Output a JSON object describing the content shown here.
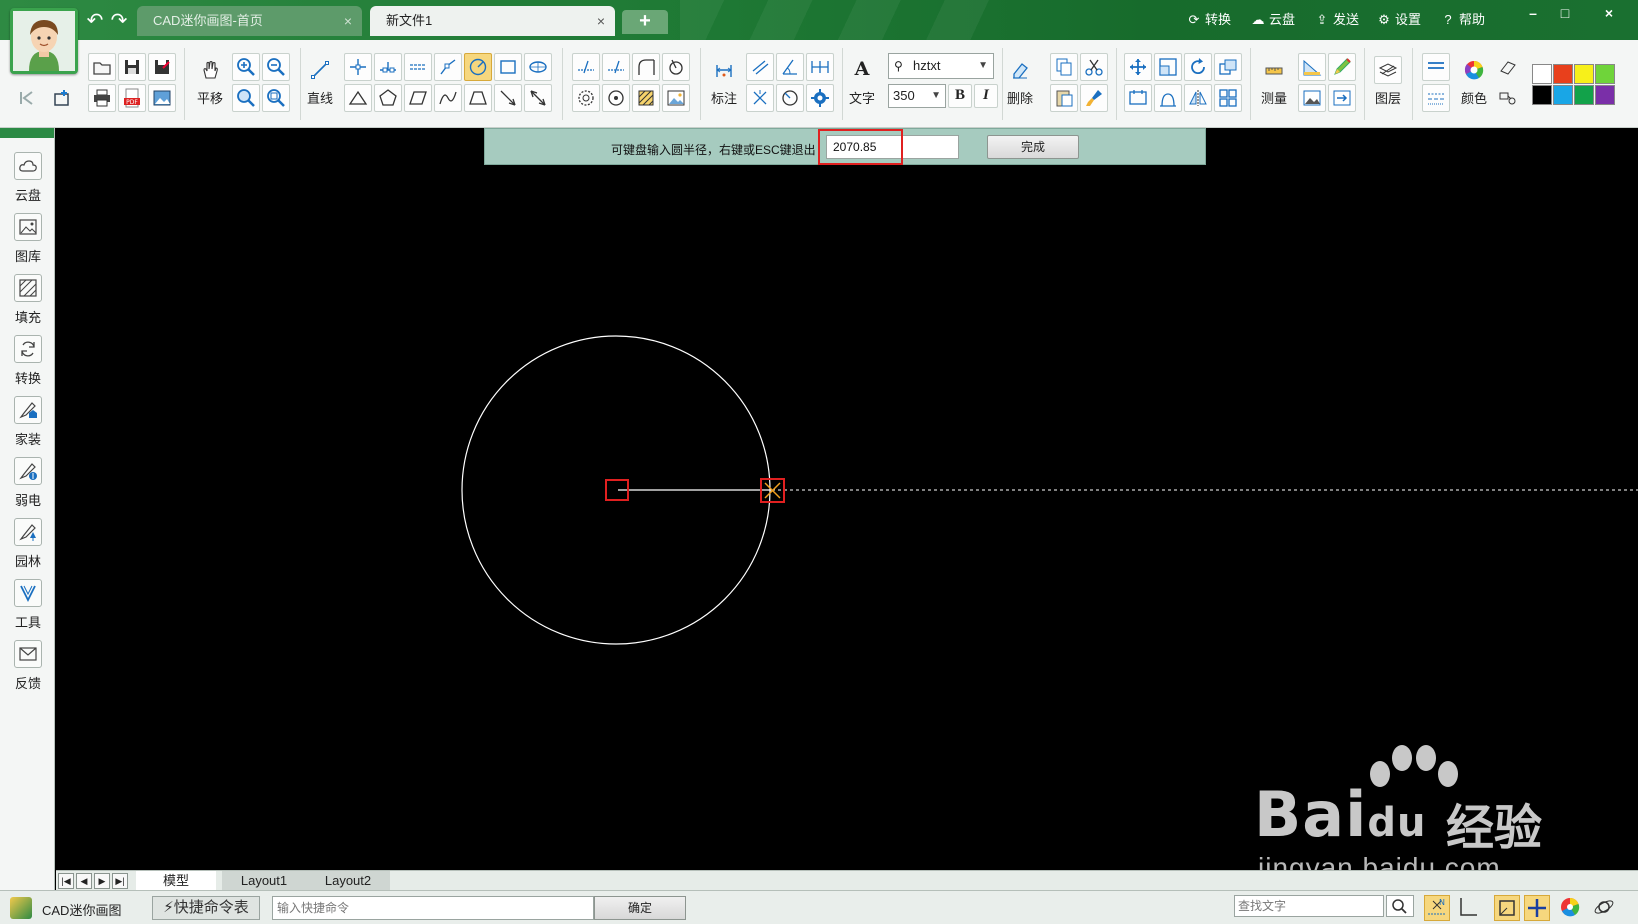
{
  "titlebar": {
    "tabs": [
      {
        "label": "CAD迷你画图-首页",
        "close": "×"
      },
      {
        "label": "新文件1",
        "close": "×"
      }
    ],
    "add_tab": "+",
    "menu": [
      {
        "label": "转换",
        "icon": "refresh-icon"
      },
      {
        "label": "云盘",
        "icon": "cloud-icon"
      },
      {
        "label": "发送",
        "icon": "send-icon"
      },
      {
        "label": "设置",
        "icon": "gear-icon"
      },
      {
        "label": "帮助",
        "icon": "help-icon"
      }
    ],
    "window_controls": [
      "–",
      "□",
      "×"
    ]
  },
  "toolbar": {
    "pan_label": "平移",
    "line_label": "直线",
    "dimension_label": "标注",
    "text_label": "文字",
    "font_name": "hztxt",
    "font_size": "350",
    "bold_label": "B",
    "italic_label": "I",
    "delete_label": "删除",
    "measure_label": "测量",
    "layer_label": "图层",
    "color_label": "颜色",
    "swatches": [
      "#ffffff",
      "#e8401c",
      "#f7f01a",
      "#6fd43a",
      "#000000",
      "#19a6e6",
      "#12a24a",
      "#7a2fa8"
    ]
  },
  "sidebar": {
    "items": [
      {
        "label": "云盘",
        "icon": "cloud-icon"
      },
      {
        "label": "图库",
        "icon": "gallery-icon"
      },
      {
        "label": "填充",
        "icon": "hatch-icon"
      },
      {
        "label": "转换",
        "icon": "convert-icon"
      },
      {
        "label": "家装",
        "icon": "home-decor-icon"
      },
      {
        "label": "弱电",
        "icon": "low-voltage-icon"
      },
      {
        "label": "园林",
        "icon": "garden-icon"
      },
      {
        "label": "工具",
        "icon": "tools-icon"
      },
      {
        "label": "反馈",
        "icon": "mail-icon"
      }
    ]
  },
  "prompt": {
    "text": "可键盘输入圆半径，右键或ESC键退出",
    "radius_value": "2070.85",
    "done_label": "完成"
  },
  "layout_tabs": [
    "模型",
    "Layout1",
    "Layout2"
  ],
  "watermark": {
    "main": "Bai",
    "du": "du",
    "cn": "经验",
    "url": "jingyan.baidu.com"
  },
  "statusbar": {
    "app_name": "CAD迷你画图",
    "shortcut_label": "⚡快捷命令表",
    "command_placeholder": "输入快捷命令",
    "ok_label": "确定",
    "search_placeholder": "查找文字"
  }
}
